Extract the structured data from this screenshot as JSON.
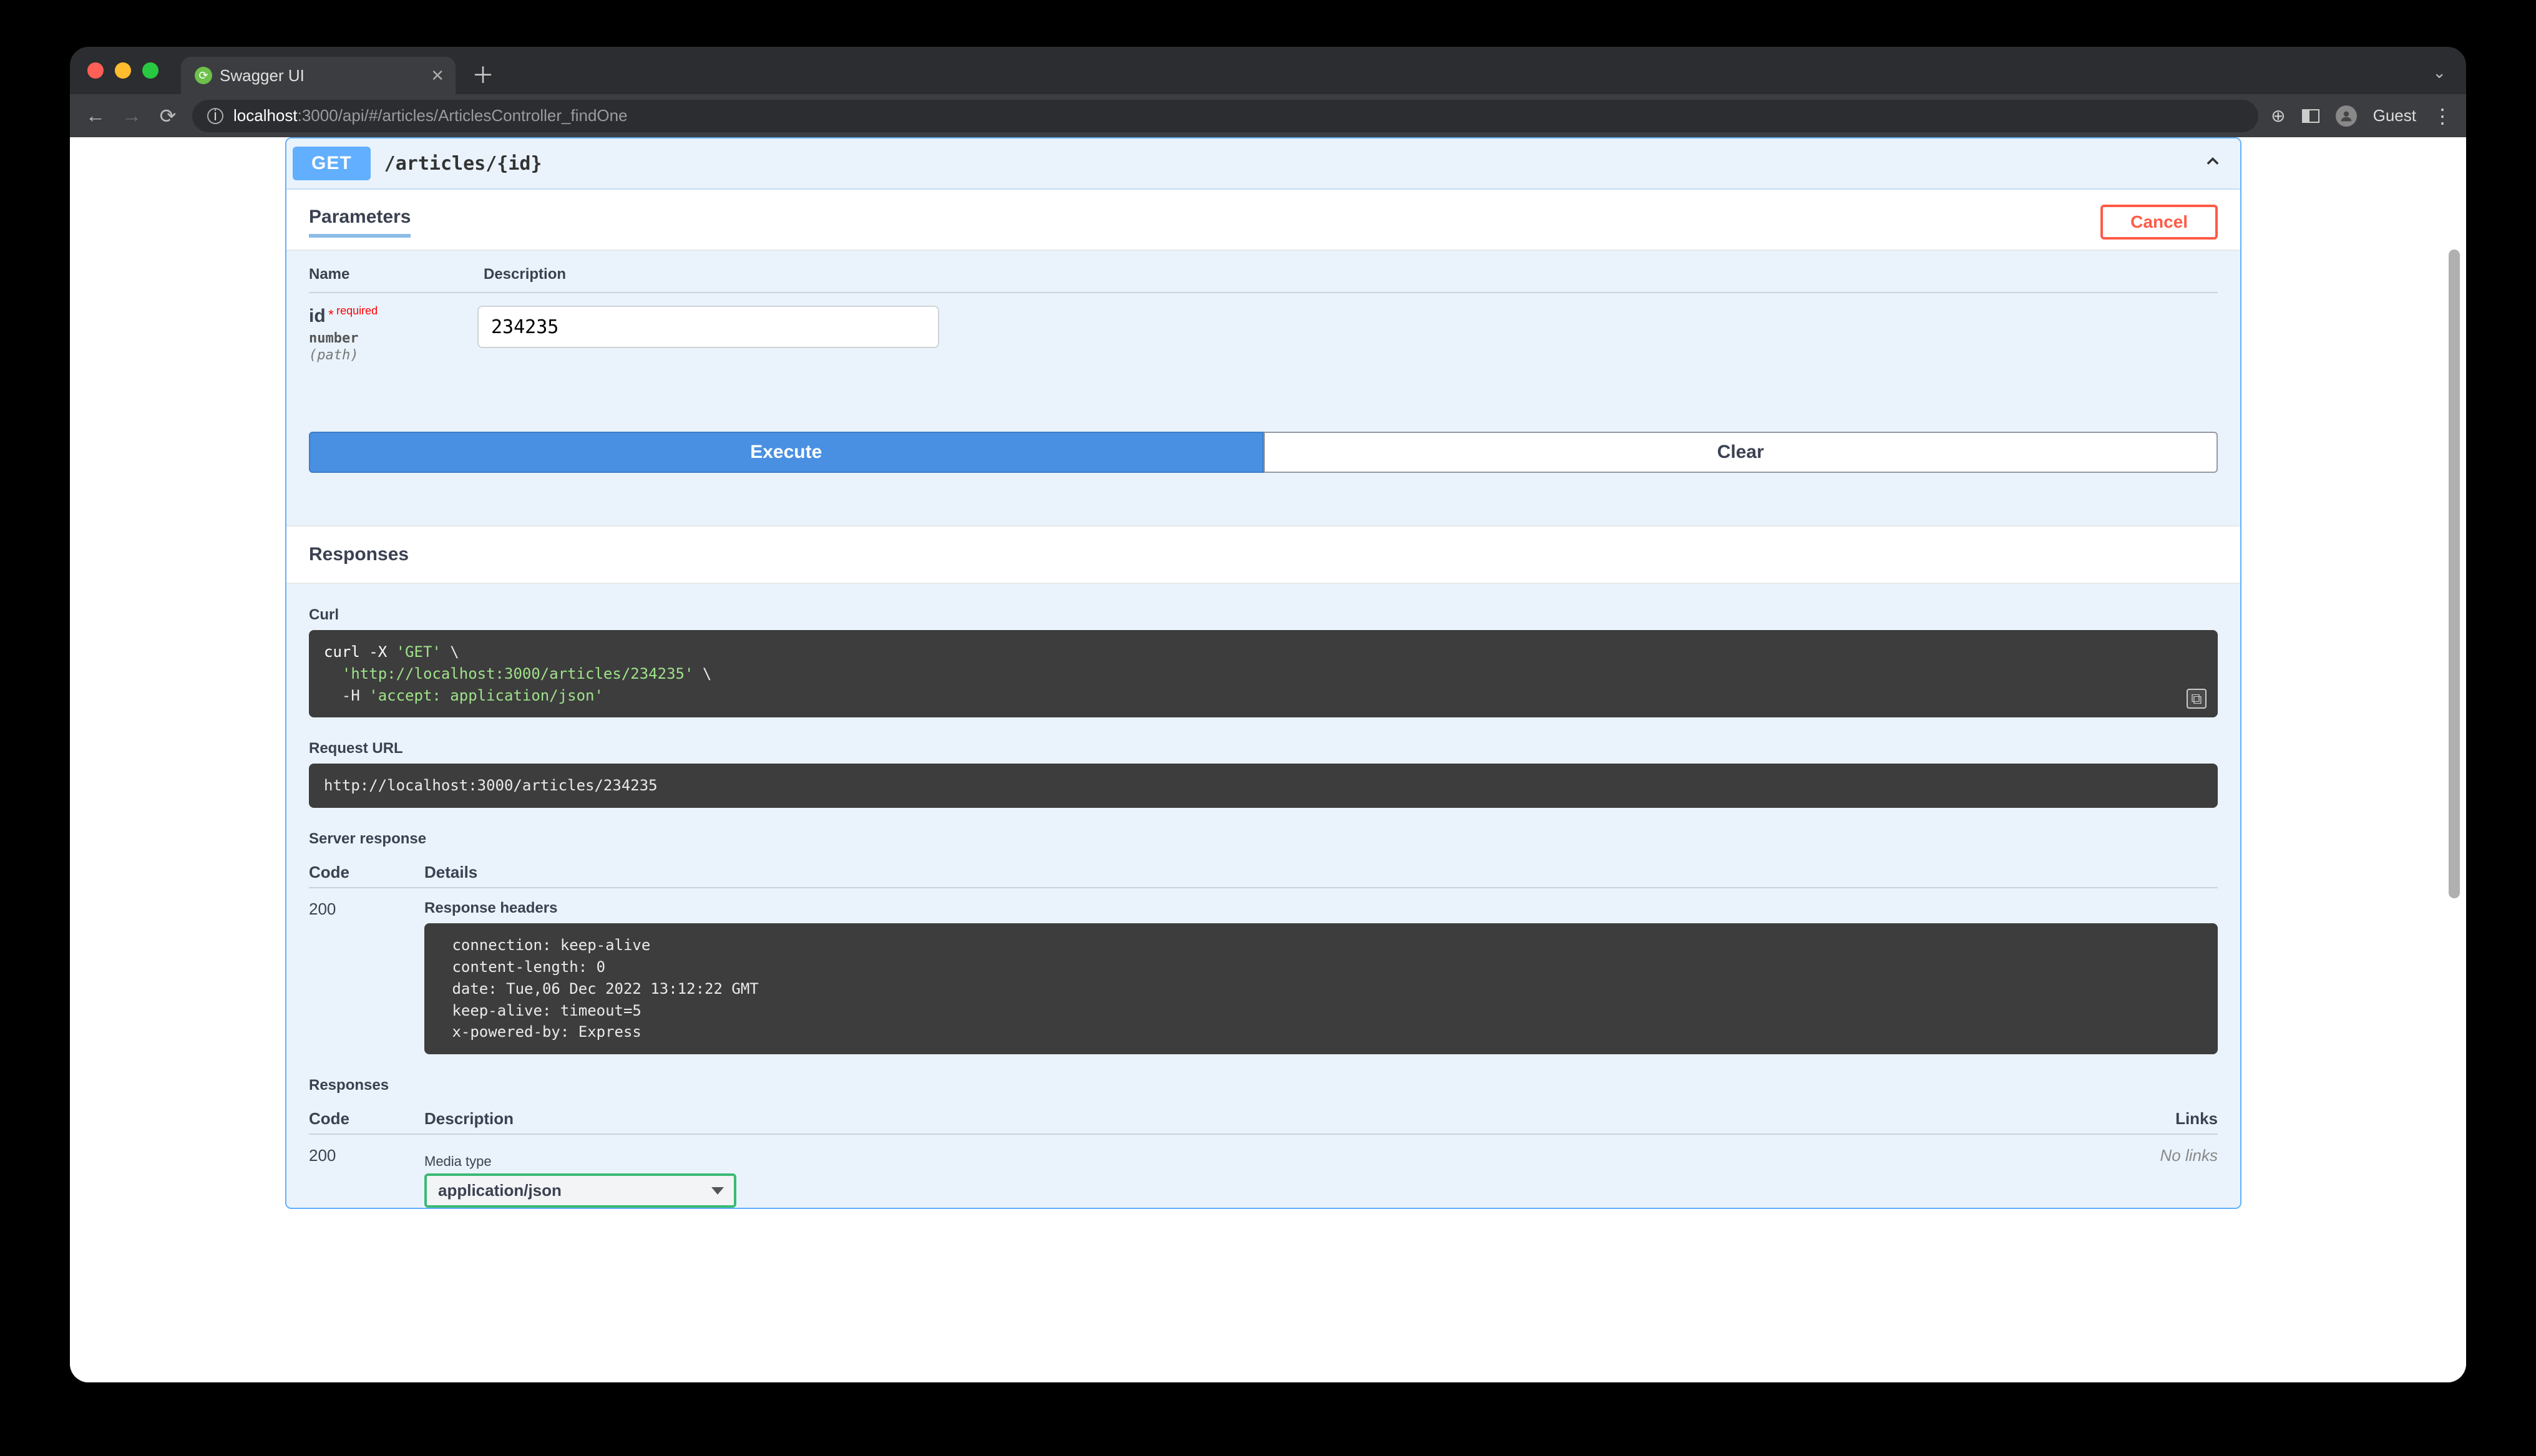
{
  "browser": {
    "tab_title": "Swagger UI",
    "url_host": "localhost",
    "url_port_path": ":3000/api/#/articles/ArticlesController_findOne",
    "guest_label": "Guest"
  },
  "operation": {
    "method": "GET",
    "path": "/articles/{id}"
  },
  "parameters": {
    "section_label": "Parameters",
    "cancel_label": "Cancel",
    "name_header": "Name",
    "desc_header": "Description",
    "rows": [
      {
        "name": "id",
        "required_label": "required",
        "type": "number",
        "in": "(path)",
        "value": "234235"
      }
    ],
    "execute_label": "Execute",
    "clear_label": "Clear"
  },
  "responses": {
    "section_label": "Responses",
    "curl_label": "Curl",
    "curl_prefix": "curl -X ",
    "curl_method": "'GET'",
    "curl_cont1": " \\",
    "curl_url_indent": "  ",
    "curl_url": "'http://localhost:3000/articles/234235'",
    "curl_cont2": " \\",
    "curl_header_indent": "  -H ",
    "curl_header": "'accept: application/json'",
    "request_url_label": "Request URL",
    "request_url": "http://localhost:3000/articles/234235",
    "server_response_label": "Server response",
    "code_header": "Code",
    "details_header": "Details",
    "status_code": "200",
    "response_headers_label": "Response headers",
    "response_headers_text": " connection: keep-alive \n content-length: 0 \n date: Tue,06 Dec 2022 13:12:22 GMT \n keep-alive: timeout=5 \n x-powered-by: Express ",
    "documented_label": "Responses",
    "desc_header2": "Description",
    "links_header": "Links",
    "doc_status_code": "200",
    "no_links": "No links",
    "media_type_label": "Media type",
    "media_type_value": "application/json"
  }
}
